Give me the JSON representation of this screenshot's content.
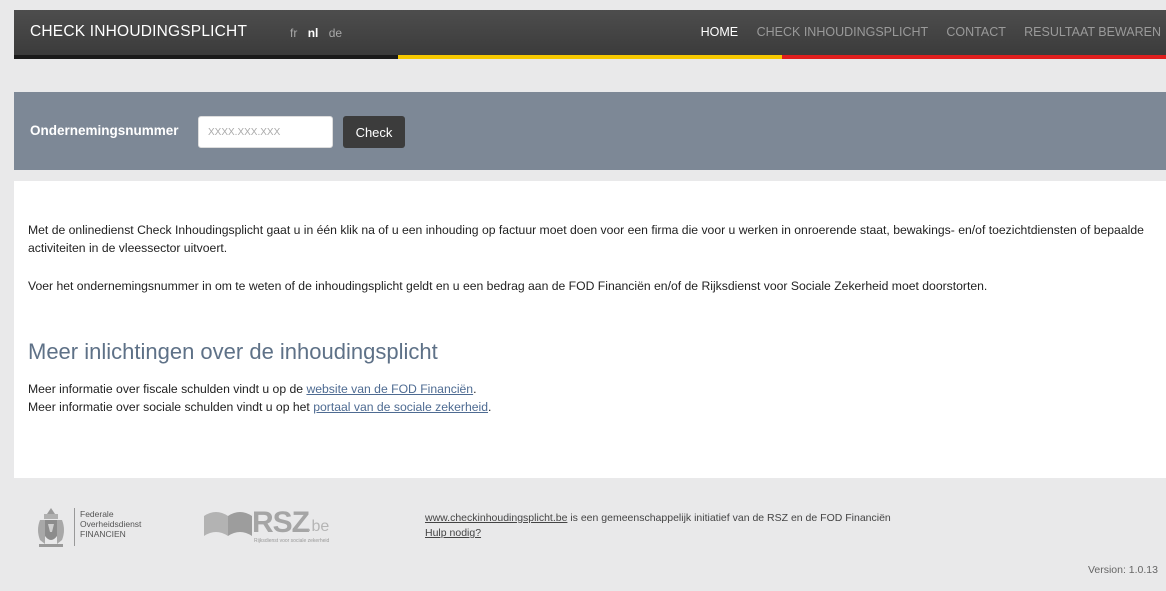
{
  "header": {
    "brand": "CHECK INHOUDINGSPLICHT",
    "languages": [
      "fr",
      "nl",
      "de"
    ],
    "active_language": "nl",
    "nav": [
      "HOME",
      "CHECK INHOUDINGSPLICHT",
      "CONTACT",
      "RESULTAAT BEWAREN"
    ],
    "active_nav": "HOME",
    "flag_colors": [
      "#1a1a1a",
      "#f5c800",
      "#e01e1e"
    ]
  },
  "search": {
    "label": "Ondernemingsnummer",
    "placeholder": "XXXX.XXX.XXX",
    "button": "Check"
  },
  "main": {
    "intro_1": "Met de onlinedienst Check Inhoudingsplicht gaat u in één klik na of u een inhouding op factuur moet doen voor een firma die voor u werken in onroerende staat, bewakings- en/of toezichtdiensten of bepaalde activiteiten in de vleessector uitvoert.",
    "intro_2": "Voer het ondernemingsnummer in om te weten of de inhoudingsplicht geldt en u een bedrag aan de FOD Financiën en/of de Rijksdienst voor Sociale Zekerheid moet doorstorten.",
    "heading": "Meer inlichtingen over de inhoudingsplicht",
    "fiscal_prefix": "Meer informatie over fiscale schulden vindt u op de ",
    "fiscal_link": "website van de FOD Financiën",
    "fiscal_suffix": ".",
    "social_prefix": "Meer informatie over sociale schulden vindt u op het ",
    "social_link": "portaal van de sociale zekerheid",
    "social_suffix": "."
  },
  "footer": {
    "fod_line1": "Federale",
    "fod_line2": "Overheidsdienst",
    "fod_line3": "FINANCIEN",
    "rsz_logo": "RSZ",
    "rsz_be": ".be",
    "rsz_sub": "Rijksdienst voor sociale zekerheid",
    "site_link": "www.checkinhoudingsplicht.be",
    "site_text": " is een gemeenschappelijk initiatief van de RSZ en de FOD Financiën",
    "help_link": "Hulp nodig?",
    "version": "Version: 1.0.13"
  }
}
